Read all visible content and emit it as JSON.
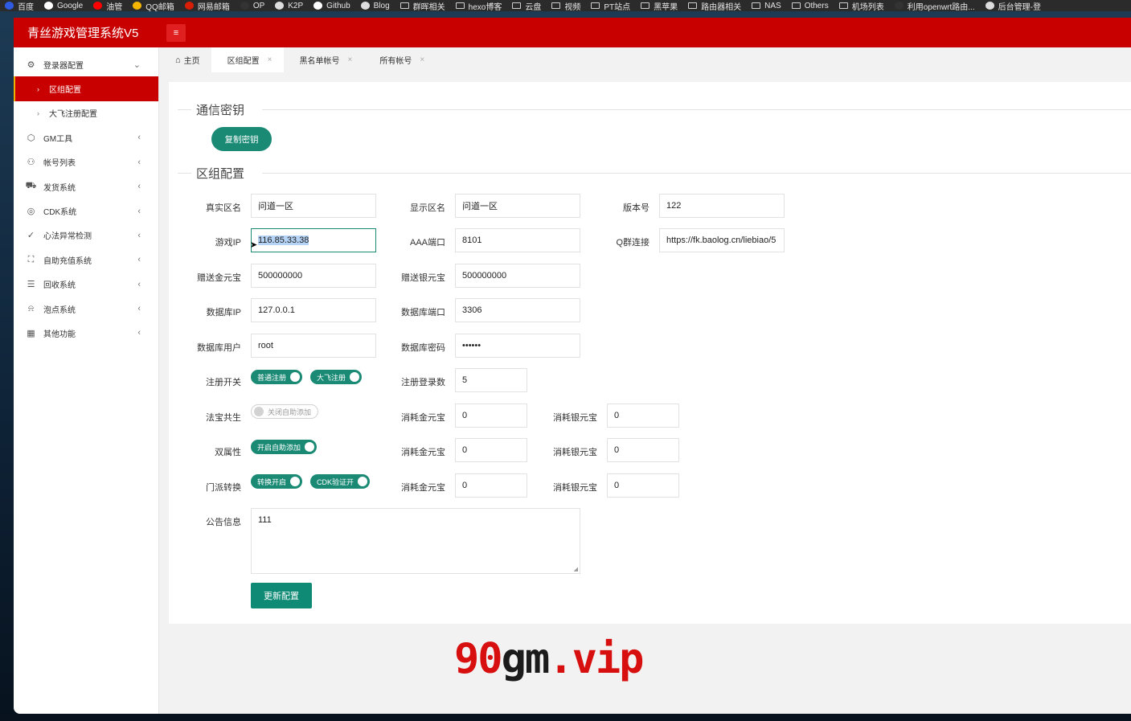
{
  "bookmarks": [
    {
      "label": "百度",
      "icon": "baidu-icon",
      "color": "#2f5be3"
    },
    {
      "label": "Google",
      "icon": "google-icon",
      "color": "#ffffff"
    },
    {
      "label": "油管",
      "icon": "youtube-icon",
      "color": "#ff0000"
    },
    {
      "label": "QQ邮箱",
      "icon": "chrome-icon",
      "color": "#f4b400"
    },
    {
      "label": "网易邮箱",
      "icon": "netease-icon",
      "color": "#d81e06"
    },
    {
      "label": "OP",
      "icon": "op-icon",
      "color": "#333333"
    },
    {
      "label": "K2P",
      "icon": "globe-icon",
      "color": "#dddddd"
    },
    {
      "label": "Github",
      "icon": "github-icon",
      "color": "#ffffff"
    },
    {
      "label": "Blog",
      "icon": "blog-icon",
      "color": "#dddddd"
    },
    {
      "label": "群晖相关",
      "icon": "folder-icon",
      "color": ""
    },
    {
      "label": "hexo博客",
      "icon": "folder-icon",
      "color": ""
    },
    {
      "label": "云盘",
      "icon": "folder-icon",
      "color": ""
    },
    {
      "label": "视频",
      "icon": "folder-icon",
      "color": ""
    },
    {
      "label": "PT站点",
      "icon": "folder-icon",
      "color": ""
    },
    {
      "label": "黑苹果",
      "icon": "folder-icon",
      "color": ""
    },
    {
      "label": "路由器相关",
      "icon": "folder-icon",
      "color": ""
    },
    {
      "label": "NAS",
      "icon": "folder-icon",
      "color": ""
    },
    {
      "label": "Others",
      "icon": "folder-icon",
      "color": ""
    },
    {
      "label": "机场列表",
      "icon": "folder-icon",
      "color": ""
    },
    {
      "label": "利用openwrt路由...",
      "icon": "site-icon",
      "color": "#333333"
    },
    {
      "label": "后台管理-登",
      "icon": "globe-icon",
      "color": "#dddddd"
    }
  ],
  "app": {
    "title": "青丝游戏管理系统V5",
    "menu_icon": "≡",
    "colors": {
      "brand": "#c90000",
      "accent": "#1a8a75"
    }
  },
  "sidebar": {
    "items": [
      {
        "label": "登录器配置",
        "icon": "gear-icon",
        "glyph": "⚙",
        "chevron": "⌄"
      },
      {
        "label": "区组配置",
        "sub": true,
        "active": true,
        "chevron": "›"
      },
      {
        "label": "大飞注册配置",
        "sub": true,
        "chevron": "›"
      },
      {
        "label": "GM工具",
        "icon": "cube-icon",
        "glyph": "⬡",
        "chevron": "‹"
      },
      {
        "label": "帐号列表",
        "icon": "user-icon",
        "glyph": "⚇",
        "chevron": "‹"
      },
      {
        "label": "发货系统",
        "icon": "truck-icon",
        "glyph": "⛟",
        "chevron": "‹"
      },
      {
        "label": "CDK系统",
        "icon": "cdk-icon",
        "glyph": "◎",
        "chevron": "‹"
      },
      {
        "label": "心法异常检测",
        "icon": "check-icon",
        "glyph": "✓",
        "chevron": "‹"
      },
      {
        "label": "自助充值系统",
        "icon": "recharge-icon",
        "glyph": "⛶",
        "chevron": "‹"
      },
      {
        "label": "回收系统",
        "icon": "database-icon",
        "glyph": "☰",
        "chevron": "‹"
      },
      {
        "label": "泡点系统",
        "icon": "bell-icon",
        "glyph": "⍾",
        "chevron": "‹"
      },
      {
        "label": "其他功能",
        "icon": "grid-icon",
        "glyph": "▦",
        "chevron": "‹"
      }
    ]
  },
  "tabs": [
    {
      "label": "主页",
      "home": true,
      "home_glyph": "⌂"
    },
    {
      "label": "区组配置",
      "close": "×",
      "active": true
    },
    {
      "label": "黑名单帐号",
      "close": "×"
    },
    {
      "label": "所有帐号",
      "close": "×"
    }
  ],
  "section_key": {
    "title": "通信密钥",
    "copy_button": "复制密钥"
  },
  "section_zone": {
    "title": "区组配置"
  },
  "form": {
    "real_zone": {
      "label": "真实区名",
      "value": "问道一区"
    },
    "display_zone": {
      "label": "显示区名",
      "value": "问道一区"
    },
    "version": {
      "label": "版本号",
      "value": "122"
    },
    "game_ip": {
      "label": "游戏IP",
      "value": "116.85.33.38"
    },
    "aaa_port": {
      "label": "AAA端口",
      "value": "8101"
    },
    "qq_group": {
      "label": "Q群连接",
      "value": "https://fk.baolog.cn/liebiao/5"
    },
    "gift_gold": {
      "label": "赠送金元宝",
      "value": "500000000"
    },
    "gift_silver": {
      "label": "赠送银元宝",
      "value": "500000000"
    },
    "db_ip": {
      "label": "数据库IP",
      "value": "127.0.0.1"
    },
    "db_port": {
      "label": "数据库端口",
      "value": "3306"
    },
    "db_user": {
      "label": "数据库用户",
      "value": "root"
    },
    "db_password": {
      "label": "数据库密码",
      "value": "••••••"
    },
    "register_switch": {
      "label": "注册开关",
      "normal": "普通注册",
      "dafei": "大飞注册"
    },
    "register_count": {
      "label": "注册登录数",
      "value": "5"
    },
    "fabao": {
      "label": "法宝共生",
      "toggle": "关闭自助添加",
      "gold_label": "消耗金元宝",
      "gold": "0",
      "silver_label": "消耗银元宝",
      "silver": "0"
    },
    "dual_attr": {
      "label": "双属性",
      "toggle": "开启自助添加",
      "gold_label": "消耗金元宝",
      "gold": "0",
      "silver_label": "消耗银元宝",
      "silver": "0"
    },
    "sect_switch": {
      "label": "门派转换",
      "toggle": "转换开启",
      "cdk_toggle": "CDK验证开",
      "gold_label": "消耗金元宝",
      "gold": "0",
      "silver_label": "消耗银元宝",
      "silver": "0"
    },
    "notice": {
      "label": "公告信息",
      "value": "111"
    },
    "update_button": "更新配置"
  },
  "watermark": {
    "part1": "90",
    "part2": "gm",
    "part3": ".",
    "part4": "vip"
  }
}
